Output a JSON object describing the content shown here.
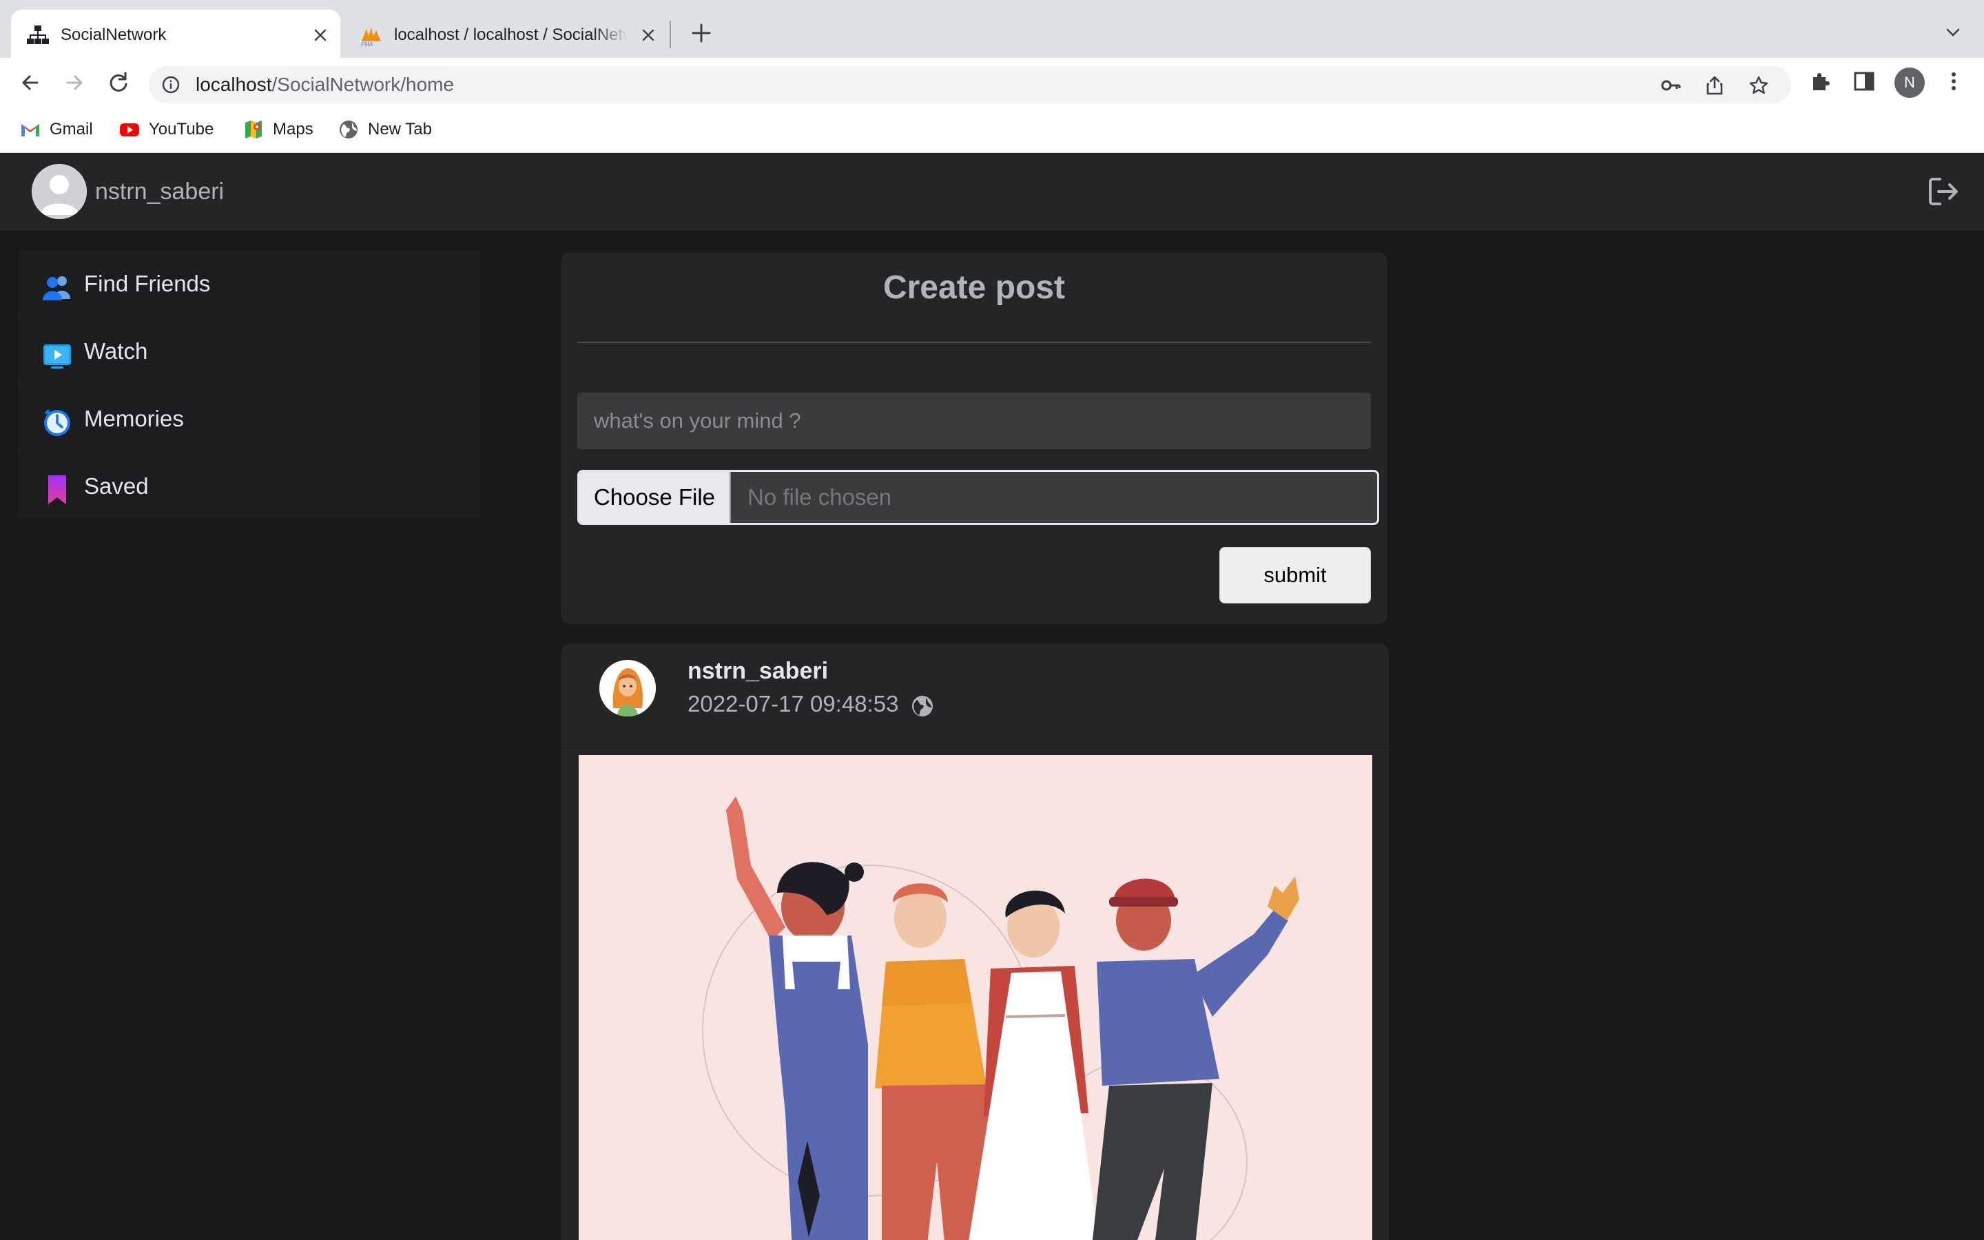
{
  "browser": {
    "tabs": [
      {
        "title": "SocialNetwork",
        "active": true,
        "icon": "network-icon"
      },
      {
        "title": "localhost / localhost / SocialNetwork",
        "active": false,
        "icon": "phpmyadmin-icon"
      }
    ],
    "url_host": "localhost",
    "url_path": "/SocialNetwork/home",
    "profile_initial": "N",
    "bookmarks": [
      {
        "label": "Gmail",
        "icon": "gmail-icon"
      },
      {
        "label": "YouTube",
        "icon": "youtube-icon"
      },
      {
        "label": "Maps",
        "icon": "maps-icon"
      },
      {
        "label": "New Tab",
        "icon": "globe-icon"
      }
    ]
  },
  "header": {
    "username": "nstrn_saberi"
  },
  "sidebar": {
    "items": [
      {
        "label": "Find Friends",
        "icon": "friends-icon"
      },
      {
        "label": "Watch",
        "icon": "watch-icon"
      },
      {
        "label": "Memories",
        "icon": "memories-icon"
      },
      {
        "label": "Saved",
        "icon": "bookmark-icon"
      }
    ]
  },
  "create_post": {
    "title": "Create post",
    "placeholder": "what's on your mind ?",
    "choose_file_label": "Choose File",
    "no_file_label": "No file chosen",
    "submit_label": "submit"
  },
  "post": {
    "author": "nstrn_saberi",
    "timestamp": "2022-07-17 09:48:53",
    "visibility": "public"
  },
  "colors": {
    "page_bg": "#18191a",
    "card_bg": "#242526",
    "text_primary": "#e4e6eb",
    "text_secondary": "#b0b3b8",
    "input_bg": "#3a3b3c"
  }
}
